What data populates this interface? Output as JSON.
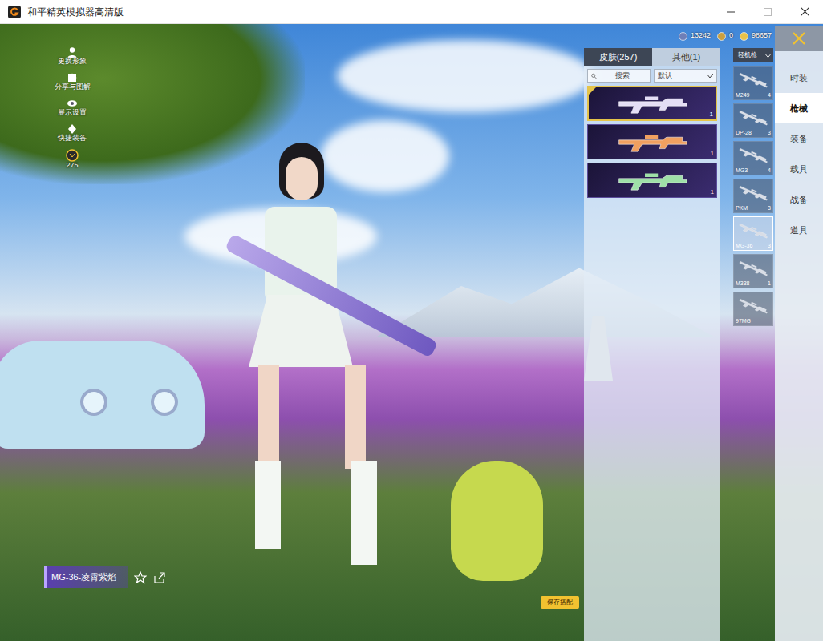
{
  "window": {
    "title": "和平精英模拟器高清版"
  },
  "currencies": [
    {
      "amount": "13242"
    },
    {
      "amount": "0"
    },
    {
      "amount": "98657"
    }
  ],
  "side_menu": {
    "items": [
      {
        "label": "更换形象"
      },
      {
        "label": "分享与图解"
      },
      {
        "label": "展示设置"
      },
      {
        "label": "快捷装备"
      }
    ],
    "level": "275"
  },
  "skin_panel": {
    "tabs": [
      {
        "label": "皮肤(257)",
        "selected": true
      },
      {
        "label": "其他(1)",
        "selected": false
      }
    ],
    "search": {
      "placeholder": "搜索"
    },
    "sort": "默认",
    "skins": [
      {
        "count": "1",
        "selected": true,
        "color": "#e4def5"
      },
      {
        "count": "1",
        "selected": false,
        "color": "#f0a060"
      },
      {
        "count": "1",
        "selected": false,
        "color": "#9fe0a8"
      }
    ]
  },
  "weapon_filter": "轻机枪",
  "weapons": [
    {
      "name": "M249",
      "count": "4",
      "selected": false
    },
    {
      "name": "DP-28",
      "count": "3",
      "selected": false
    },
    {
      "name": "MG3",
      "count": "4",
      "selected": false
    },
    {
      "name": "PKM",
      "count": "3",
      "selected": false
    },
    {
      "name": "MG-36",
      "count": "3",
      "selected": true
    },
    {
      "name": "M338",
      "count": "1",
      "selected": false
    },
    {
      "name": "97MG",
      "count": "",
      "selected": false
    }
  ],
  "categories": [
    {
      "label": "时装",
      "selected": false
    },
    {
      "label": "枪械",
      "selected": true
    },
    {
      "label": "装备",
      "selected": false
    },
    {
      "label": "载具",
      "selected": false
    },
    {
      "label": "战备",
      "selected": false
    },
    {
      "label": "道具",
      "selected": false
    }
  ],
  "item_name": "MG-36-凌霄紫焰",
  "save_button": "保存搭配"
}
